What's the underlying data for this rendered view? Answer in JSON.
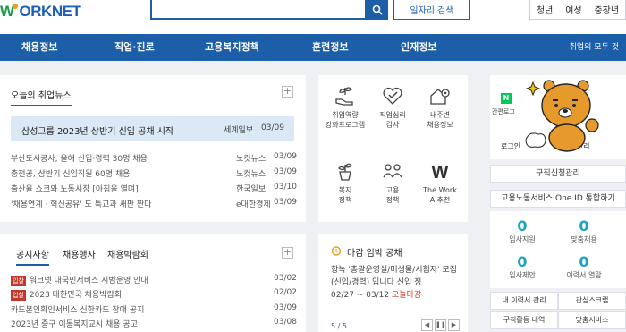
{
  "header": {
    "logo_text": "WORKNET",
    "job_search_label": "일자리 검색",
    "user_tabs": [
      "청년",
      "여성",
      "중장년"
    ]
  },
  "nav": {
    "items": [
      "채용정보",
      "직업·진로",
      "고용복지정책",
      "훈련정보",
      "인재정보"
    ],
    "all_menu": "취업의 모두 것"
  },
  "job_news": {
    "title": "오늘의 취업뉴스",
    "headline": {
      "title": "삼성그룹 2023년 상반기 신입 공채 시작",
      "source": "세계일보",
      "date": "03/09"
    },
    "items": [
      {
        "title": "부산도시공사, 올해 신입·경력 30명 채용",
        "source": "노컷뉴스",
        "date": "03/09"
      },
      {
        "title": "충전공, 상반기 신입직원 60명 채용",
        "source": "노컷뉴스",
        "date": "03/09"
      },
      {
        "title": "출산율 쇼크와 노동시장 [아침을 열며]",
        "source": "한국일보",
        "date": "03/10"
      },
      {
        "title": "'채용연계 · 혁신공유' 도 특교과 새판 짠다",
        "source": "e대한경제",
        "date": "03/09"
      }
    ]
  },
  "services": [
    {
      "label_1": "취업역량",
      "label_2": "강화프로그램",
      "icon": "hand-plant-icon"
    },
    {
      "label_1": "직업심리",
      "label_2": "검사",
      "icon": "heart-check-icon"
    },
    {
      "label_1": "내주변",
      "label_2": "채용정보",
      "icon": "house-pin-icon"
    },
    {
      "label_1": "복지",
      "label_2": "정책",
      "icon": "plant-pot-icon"
    },
    {
      "label_1": "고용",
      "label_2": "정책",
      "icon": "people-icon"
    },
    {
      "label_1": "The Work",
      "label_2": "AI추천",
      "icon": "w-logo-icon"
    }
  ],
  "deadline": {
    "title": "마감 임박 공채",
    "body": "항녹 '총괄운영실/미생물/시험자' 모집 (신입/경력) 입니다 신입 정",
    "period": "02/27 ~ 03/12",
    "badge": "오늘마감",
    "pager": "5 / 5"
  },
  "notices": {
    "tabs": [
      "공지사항",
      "채용행사",
      "채용박람회"
    ],
    "items": [
      {
        "tag": "입찰",
        "title": "워크넷 대국민서비스 시범운영 안내",
        "date": "03/02"
      },
      {
        "tag": "입찰",
        "title": "2023 대한민국 채용박람회",
        "date": "02/02"
      },
      {
        "tag": "",
        "title": "카드본인확인서비스 신한카드 장애 공지",
        "date": "03/09"
      },
      {
        "tag": "",
        "title": "2023년 중구 이동복지교시 채용 공고",
        "date": "03/08"
      }
    ]
  },
  "right": {
    "naver_label": "N",
    "login_label": "로그인",
    "member_label": "회원관리",
    "kr_partial": "간편로그",
    "apply_manage": "구직신청관리",
    "oneid": "고용노동서비스 One ID 통합하기",
    "stats": [
      {
        "value": "0",
        "label": "입사지원"
      },
      {
        "value": "0",
        "label": "맞춤채용"
      },
      {
        "value": "0",
        "label": "입사제안"
      },
      {
        "value": "0",
        "label": "이력서 열람"
      }
    ],
    "buttons": [
      "내 이력서 관리",
      "관심스크랩",
      "구직활동 내역",
      "맞춤서비스"
    ]
  },
  "colors": {
    "brand": "#1d5ea8",
    "accent": "#1aa4c0",
    "tag": "#c0392b"
  }
}
